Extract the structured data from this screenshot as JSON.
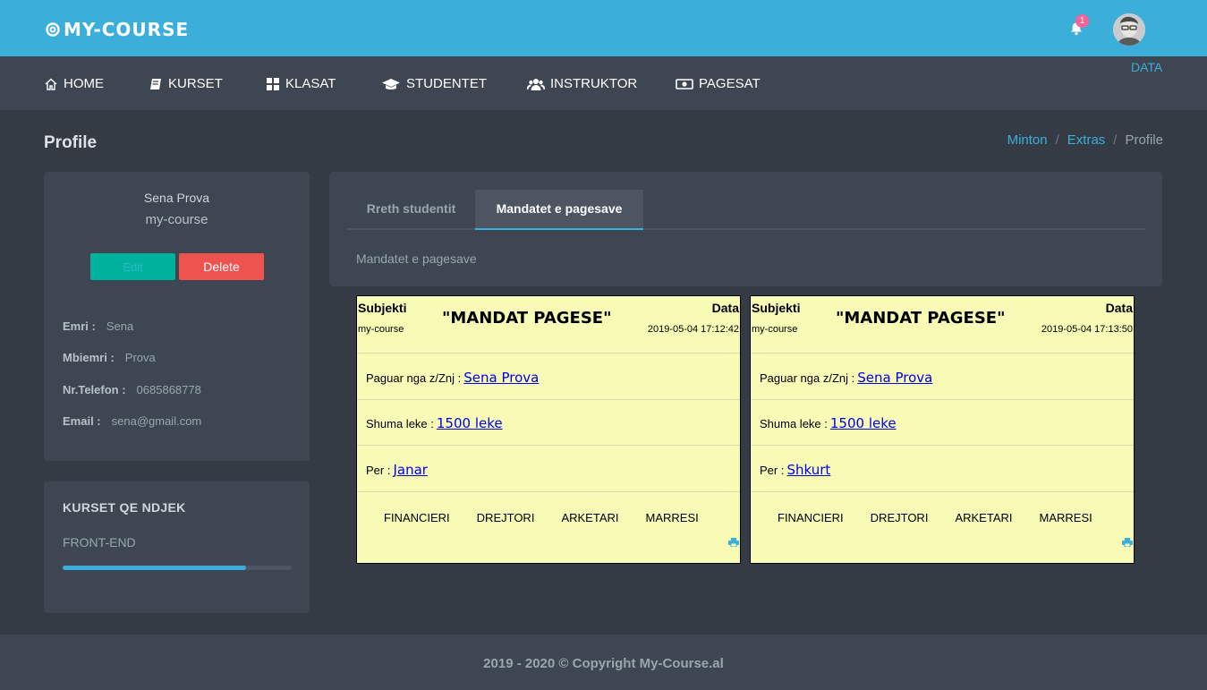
{
  "app": {
    "logo_text": "MY-COURSE"
  },
  "topbar": {
    "notification_count": "1",
    "user_label": "DATA"
  },
  "nav": {
    "items": [
      {
        "label": "HOME",
        "icon": "home-icon"
      },
      {
        "label": "KURSET",
        "icon": "book-icon"
      },
      {
        "label": "KLASAT",
        "icon": "grid-icon"
      },
      {
        "label": "STUDENTET",
        "icon": "graduation-cap-icon"
      },
      {
        "label": "INSTRUKTOR",
        "icon": "users-icon"
      },
      {
        "label": "PAGESAT",
        "icon": "money-icon"
      }
    ]
  },
  "page": {
    "title": "Profile",
    "breadcrumb": [
      "Minton",
      "Extras",
      "Profile"
    ],
    "breadcrumb_sep": "/"
  },
  "profile": {
    "name": "Sena Prova",
    "subtitle": "my-course",
    "edit_label": "Edit",
    "delete_label": "Delete",
    "fields": [
      {
        "label": "Emri :",
        "value": "Sena"
      },
      {
        "label": "Mbiemri :",
        "value": "Prova"
      },
      {
        "label": "Nr.Telefon :",
        "value": "0685868778"
      },
      {
        "label": "Email :",
        "value": "sena@gmail.com"
      }
    ]
  },
  "courses": {
    "title": "KURSET QE NDJEK",
    "items": [
      {
        "name": "FRONT-END",
        "progress": 0.8
      }
    ]
  },
  "tabs": {
    "items": [
      {
        "label": "Rreth studentit",
        "active": false
      },
      {
        "label": "Mandatet e pagesave",
        "active": true
      }
    ],
    "content": "Mandatet e pagesave"
  },
  "mandates": [
    {
      "subject_label": "Subjekti",
      "subject": "my-course",
      "title": "\"MANDAT PAGESE\"",
      "date_label": "Data",
      "date": "2019-05-04 17:12:42",
      "paid_by_label": "Paguar nga z/Znj :",
      "paid_by": "Sena Prova",
      "amount_label": "Shuma leke :",
      "amount": "1500 leke",
      "for_label": "Per :",
      "for": "Janar",
      "signatures": [
        "FINANCIERI",
        "DREJTORI",
        "ARKETARI",
        "MARRESI"
      ]
    },
    {
      "subject_label": "Subjekti",
      "subject": "my-course",
      "title": "\"MANDAT PAGESE\"",
      "date_label": "Data",
      "date": "2019-05-04 17:13:50",
      "paid_by_label": "Paguar nga z/Znj :",
      "paid_by": "Sena Prova",
      "amount_label": "Shuma leke :",
      "amount": "1500 leke",
      "for_label": "Per :",
      "for": "Shkurt",
      "signatures": [
        "FINANCIERI",
        "DREJTORI",
        "ARKETARI",
        "MARRESI"
      ]
    }
  ],
  "footer": {
    "text": "2019 - 2020 © Copyright My-Course.al"
  },
  "colors": {
    "accent": "#3bafda",
    "success": "#00b19d",
    "danger": "#ef5350",
    "badge": "#f76397"
  }
}
